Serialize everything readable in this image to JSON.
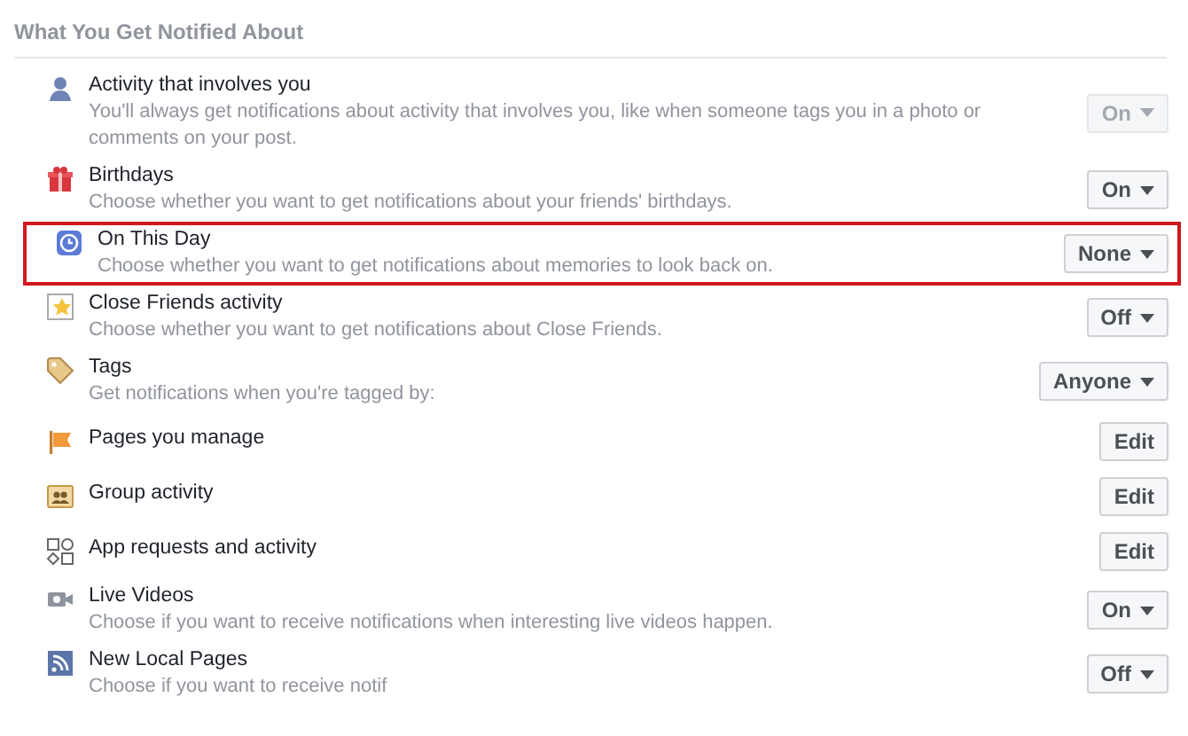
{
  "section_title": "What You Get Notified About",
  "rows": [
    {
      "title": "Activity that involves you",
      "description": "You'll always get notifications about activity that involves you, like when someone tags you in a photo or comments on your post.",
      "kind": "dropdown",
      "value": "On",
      "disabled": true,
      "highlighted": false
    },
    {
      "title": "Birthdays",
      "description": "Choose whether you want to get notifications about your friends' birthdays.",
      "kind": "dropdown",
      "value": "On",
      "disabled": false,
      "highlighted": false
    },
    {
      "title": "On This Day",
      "description": "Choose whether you want to get notifications about memories to look back on.",
      "kind": "dropdown",
      "value": "None",
      "disabled": false,
      "highlighted": true
    },
    {
      "title": "Close Friends activity",
      "description": "Choose whether you want to get notifications about Close Friends.",
      "kind": "dropdown",
      "value": "Off",
      "disabled": false,
      "highlighted": false
    },
    {
      "title": "Tags",
      "description": "Get notifications when you're tagged by:",
      "kind": "dropdown",
      "value": "Anyone",
      "disabled": false,
      "highlighted": false
    },
    {
      "title": "Pages you manage",
      "kind": "edit",
      "value": "Edit",
      "highlighted": false
    },
    {
      "title": "Group activity",
      "kind": "edit",
      "value": "Edit",
      "highlighted": false
    },
    {
      "title": "App requests and activity",
      "kind": "edit",
      "value": "Edit",
      "highlighted": false
    },
    {
      "title": "Live Videos",
      "description": "Choose if you want to receive notifications when interesting live videos happen.",
      "kind": "dropdown",
      "value": "On",
      "disabled": false,
      "highlighted": false
    },
    {
      "title": "New Local Pages",
      "description": "Choose if you want to receive notif",
      "kind": "dropdown",
      "value": "Off",
      "disabled": false,
      "highlighted": false
    }
  ]
}
